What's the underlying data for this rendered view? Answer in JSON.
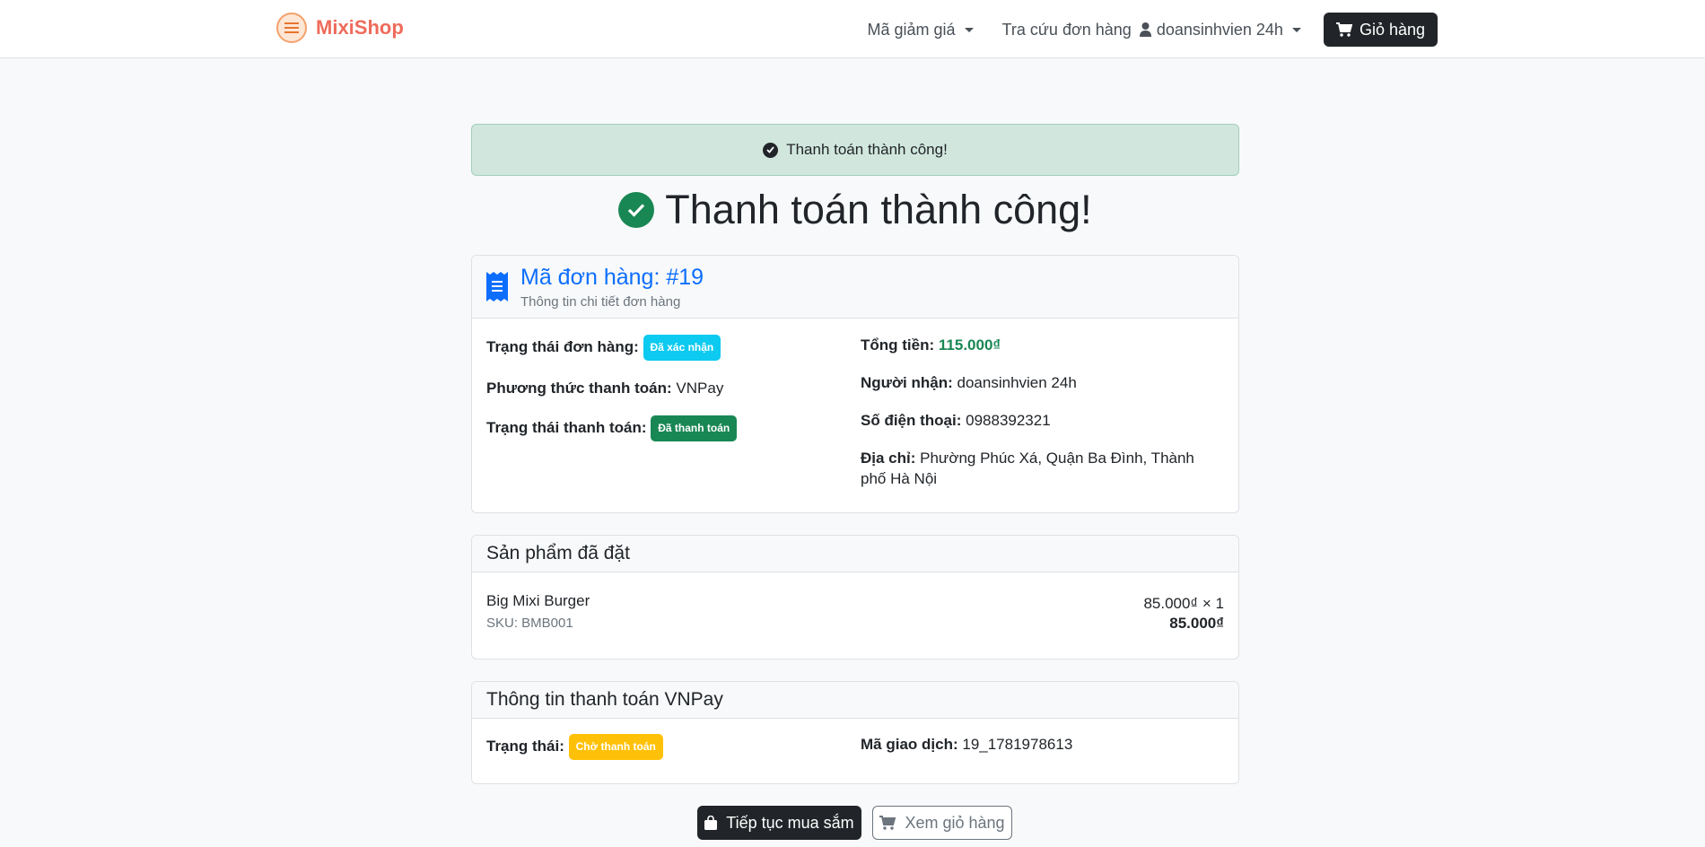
{
  "navbar": {
    "brand": "MixiShop",
    "discount_label": "Mã giảm giá",
    "order_lookup_label": "Tra cứu đơn hàng",
    "user_label": "doansinhvien 24h",
    "cart_label": "Giỏ hàng"
  },
  "alert": {
    "text": "Thanh toán thành công!"
  },
  "page_title": "Thanh toán thành công!",
  "order": {
    "title": "Mã đơn hàng: #19",
    "subtitle": "Thông tin chi tiết đơn hàng",
    "status_label": "Trạng thái đơn hàng:",
    "status_value": "Đã xác nhận",
    "method_label": "Phương thức thanh toán:",
    "method_value": "VNPay",
    "payment_status_label": "Trạng thái thanh toán:",
    "payment_status_value": "Đã thanh toán",
    "total_label": "Tổng tiền:",
    "total_value": "115.000₫",
    "recipient_label": "Người nhận:",
    "recipient_value": "doansinhvien 24h",
    "phone_label": "Số điện thoại:",
    "phone_value": "0988392321",
    "address_label": "Địa chỉ:",
    "address_value": "Phường Phúc Xá, Quận Ba Đình, Thành phố Hà Nội"
  },
  "products": {
    "header": "Sản phẩm đã đặt",
    "items": [
      {
        "name": "Big Mixi Burger",
        "sku": "SKU: BMB001",
        "unit": "85.000₫ × 1",
        "subtotal": "85.000₫"
      }
    ]
  },
  "vnpay": {
    "header": "Thông tin thanh toán VNPay",
    "status_label": "Trạng thái:",
    "status_value": "Chờ thanh toán",
    "txn_label": "Mã giao dịch:",
    "txn_value": "19_1781978613"
  },
  "actions": {
    "continue_label": "Tiếp tục mua sắm",
    "view_cart_label": "Xem giỏ hàng"
  },
  "colors": {
    "success": "#198754",
    "primary": "#0d6efd",
    "info": "#0dcaf0",
    "warning": "#ffc107",
    "brand": "#ef6b5b"
  }
}
